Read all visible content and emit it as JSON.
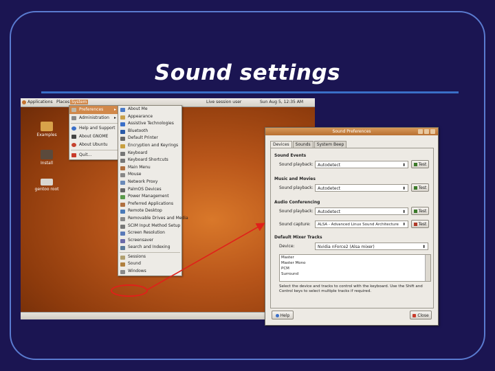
{
  "slide": {
    "title": "Sound settings"
  },
  "colors": {
    "slide_background": "#1b1552",
    "frame_border": "#5a7bd0",
    "title_rule": "#3a6fc8",
    "highlight": "#e0201a",
    "menu_selection": "#d1884a"
  },
  "topbar": {
    "menu_applications": "Applications",
    "menu_places": "Places",
    "menu_system": "System",
    "user": "Live session user",
    "clock": "Sun Aug 5, 12:35 AM"
  },
  "desktop_icons": [
    {
      "label": "Examples",
      "icon": "folder-icon"
    },
    {
      "label": "Install",
      "icon": "install-icon"
    },
    {
      "label": "gentoo root",
      "icon": "drive-icon"
    }
  ],
  "system_menu": {
    "items": [
      {
        "label": "Preferences",
        "icon": "preferences-icon",
        "submenu": true,
        "selected": true
      },
      {
        "label": "Administration",
        "icon": "admin-icon",
        "submenu": true
      },
      {
        "label": "Help and Support",
        "icon": "help-icon"
      },
      {
        "label": "About GNOME",
        "icon": "gnome-icon"
      },
      {
        "label": "About Ubuntu",
        "icon": "ubuntu-icon"
      },
      {
        "label": "Quit...",
        "icon": "quit-icon"
      }
    ]
  },
  "preferences_menu": {
    "items": [
      {
        "label": "About Me",
        "icon": "person-icon"
      },
      {
        "label": "Appearance",
        "icon": "appearance-icon"
      },
      {
        "label": "Assistive Technologies",
        "icon": "accessibility-icon"
      },
      {
        "label": "Bluetooth",
        "icon": "bluetooth-icon"
      },
      {
        "label": "Default Printer",
        "icon": "printer-icon"
      },
      {
        "label": "Encryption and Keyrings",
        "icon": "key-icon"
      },
      {
        "label": "Keyboard",
        "icon": "keyboard-icon"
      },
      {
        "label": "Keyboard Shortcuts",
        "icon": "shortcut-icon"
      },
      {
        "label": "Main Menu",
        "icon": "menu-icon"
      },
      {
        "label": "Mouse",
        "icon": "mouse-icon"
      },
      {
        "label": "Network Proxy",
        "icon": "network-icon"
      },
      {
        "label": "PalmOS Devices",
        "icon": "palm-icon"
      },
      {
        "label": "Power Management",
        "icon": "power-icon"
      },
      {
        "label": "Preferred Applications",
        "icon": "apps-icon"
      },
      {
        "label": "Remote Desktop",
        "icon": "remote-icon"
      },
      {
        "label": "Removable Drives and Media",
        "icon": "drive-icon"
      },
      {
        "label": "SCIM Input Method Setup",
        "icon": "input-icon"
      },
      {
        "label": "Screen Resolution",
        "icon": "screen-icon"
      },
      {
        "label": "Screensaver",
        "icon": "screensaver-icon"
      },
      {
        "label": "Search and Indexing",
        "icon": "search-icon"
      },
      {
        "label": "Sessions",
        "icon": "session-icon"
      },
      {
        "label": "Sound",
        "icon": "sound-icon"
      },
      {
        "label": "Windows",
        "icon": "window-icon"
      }
    ]
  },
  "sound_dialog": {
    "title": "Sound Preferences",
    "tabs": [
      "Devices",
      "Sounds",
      "System Beep"
    ],
    "active_tab": "Devices",
    "sections": {
      "sound_events": {
        "heading": "Sound Events",
        "row_label": "Sound playback:",
        "value": "Autodetect",
        "test_label": "Test"
      },
      "music_movies": {
        "heading": "Music and Movies",
        "row_label": "Sound playback:",
        "value": "Autodetect",
        "test_label": "Test"
      },
      "audio_conferencing": {
        "heading": "Audio Conferencing",
        "playback_label": "Sound playback:",
        "playback_value": "Autodetect",
        "capture_label": "Sound capture:",
        "capture_value": "ALSA - Advanced Linux Sound Architecture",
        "test_label": "Test"
      },
      "mixer_tracks": {
        "heading": "Default Mixer Tracks",
        "device_label": "Device:",
        "device_value": "Nvidia nForce2 (Alsa mixer)",
        "tracks": [
          "Master",
          "Master Mono",
          "PCM",
          "Surround"
        ],
        "hint": "Select the device and tracks to control with the keyboard. Use the Shift and Control keys to select multiple tracks if required."
      }
    },
    "help_label": "Help",
    "close_label": "Close"
  }
}
